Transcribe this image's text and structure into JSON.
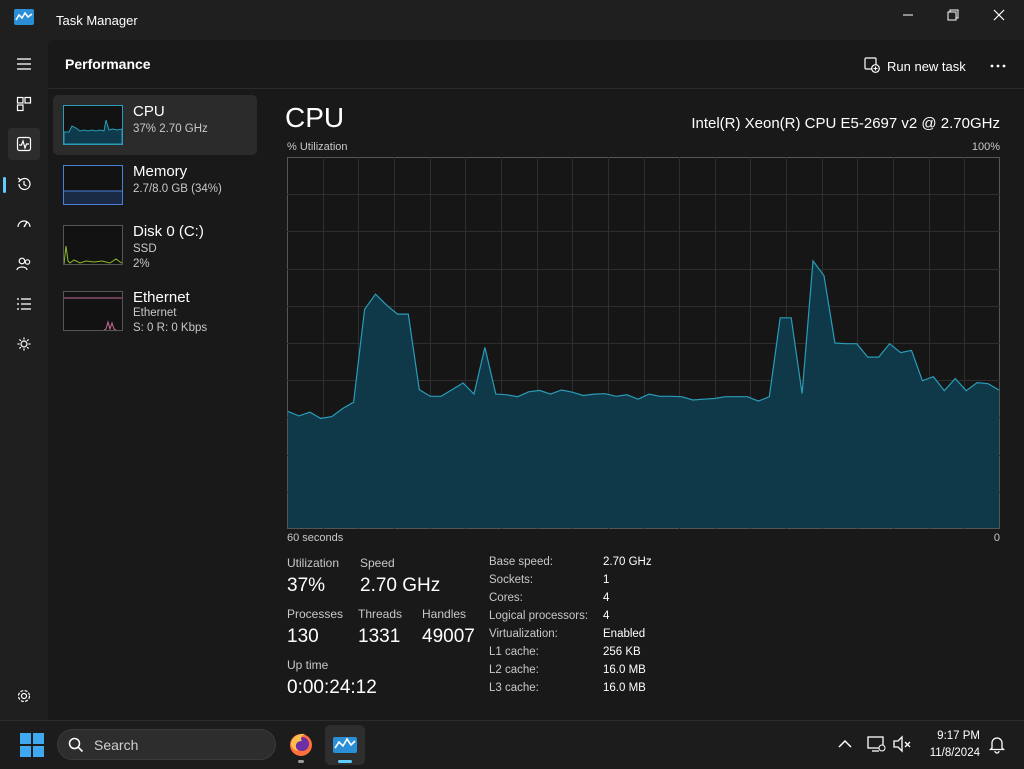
{
  "window": {
    "title": "Task Manager"
  },
  "colors": {
    "accent": "#60cdff",
    "cpu_line": "#2a9bb8",
    "cpu_fill": "#0f3a4b",
    "memory": "#4a7fd6",
    "disk": "#8bb92b",
    "ethernet": "#c46a9a"
  },
  "rail": {
    "items": [
      {
        "name": "hamburger-menu-icon"
      },
      {
        "name": "processes-icon"
      },
      {
        "name": "performance-icon",
        "active": true
      },
      {
        "name": "app-history-icon"
      },
      {
        "name": "startup-apps-icon"
      },
      {
        "name": "users-icon"
      },
      {
        "name": "details-icon"
      },
      {
        "name": "services-icon"
      },
      {
        "name": "settings-icon"
      }
    ]
  },
  "commandbar": {
    "title": "Performance",
    "run_new_task": "Run new task",
    "more": "more-options-icon"
  },
  "devices": [
    {
      "name": "CPU",
      "sub1": "37%  2.70 GHz",
      "selected": true
    },
    {
      "name": "Memory",
      "sub1": "2.7/8.0 GB (34%)"
    },
    {
      "name": "Disk 0 (C:)",
      "sub1": "SSD",
      "sub2": "2%"
    },
    {
      "name": "Ethernet",
      "sub1": "Ethernet",
      "sub2": "S: 0 R: 0 Kbps"
    }
  ],
  "detail": {
    "title": "CPU",
    "model": "Intel(R) Xeon(R) CPU E5-2697 v2 @ 2.70GHz",
    "graph_ylabel": "% Utilization",
    "graph_ymax": "100%",
    "graph_xleft": "60 seconds",
    "graph_xright": "0"
  },
  "chart_data": {
    "type": "area",
    "ylabel": "% Utilization",
    "ylim": [
      0,
      100
    ],
    "x_span_seconds": 60,
    "grid": true,
    "values": [
      31.5,
      30.3,
      31.3,
      29.6,
      30.1,
      32.3,
      34.0,
      59.1,
      63.2,
      60.3,
      57.8,
      57.8,
      37.4,
      35.6,
      35.6,
      37.4,
      39.2,
      36.2,
      48.8,
      36.2,
      36.0,
      35.5,
      36.8,
      37.2,
      36.2,
      37.3,
      36.7,
      35.8,
      36.2,
      36.3,
      35.6,
      36.0,
      34.8,
      36.2,
      35.6,
      35.6,
      35.5,
      34.6,
      34.8,
      35.0,
      35.5,
      35.5,
      35.5,
      34.3,
      35.5,
      56.8,
      56.8,
      36.3,
      72.2,
      68.2,
      50.0,
      49.8,
      49.8,
      46.2,
      46.2,
      49.8,
      47.4,
      48.0,
      39.8,
      40.9,
      37.1,
      40.4,
      37.1,
      39.3,
      39.0,
      37.3
    ]
  },
  "stats": {
    "utilization": {
      "label": "Utilization",
      "value": "37%"
    },
    "speed": {
      "label": "Speed",
      "value": "2.70 GHz"
    },
    "processes": {
      "label": "Processes",
      "value": "130"
    },
    "threads": {
      "label": "Threads",
      "value": "1331"
    },
    "handles": {
      "label": "Handles",
      "value": "49007"
    },
    "uptime": {
      "label": "Up time",
      "value": "0:00:24:12"
    }
  },
  "specs": [
    {
      "k": "Base speed:",
      "v": "2.70 GHz"
    },
    {
      "k": "Sockets:",
      "v": "1"
    },
    {
      "k": "Cores:",
      "v": "4"
    },
    {
      "k": "Logical processors:",
      "v": "4"
    },
    {
      "k": "Virtualization:",
      "v": "Enabled"
    },
    {
      "k": "L1 cache:",
      "v": "256 KB"
    },
    {
      "k": "L2 cache:",
      "v": "16.0 MB"
    },
    {
      "k": "L3 cache:",
      "v": "16.0 MB"
    }
  ],
  "taskbar": {
    "search_placeholder": "Search",
    "time": "9:17 PM",
    "date": "11/8/2024",
    "apps": [
      {
        "name": "firefox-icon"
      },
      {
        "name": "task-manager-icon",
        "active": true
      }
    ]
  }
}
